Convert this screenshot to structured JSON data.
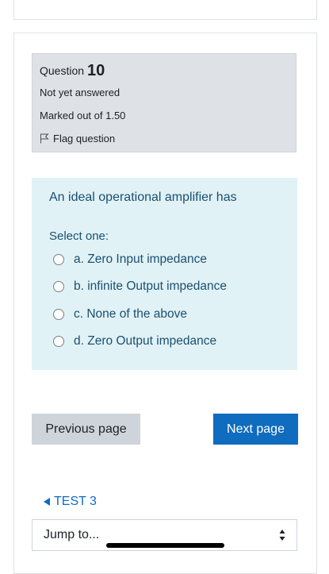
{
  "question": {
    "label": "Question",
    "number": "10",
    "status": "Not yet answered",
    "marks": "Marked out of 1.50",
    "flag_label": "Flag question"
  },
  "formulation": {
    "text": "An ideal operational amplifier has",
    "prompt": "Select one:",
    "options": [
      {
        "label": "a. Zero Input impedance",
        "selected": false
      },
      {
        "label": "b. infinite Output impedance",
        "selected": false
      },
      {
        "label": "c. None of the above",
        "selected": false
      },
      {
        "label": "d. Zero Output impedance",
        "selected": false
      }
    ]
  },
  "navigation": {
    "previous_label": "Previous page",
    "next_label": "Next page",
    "back_link": "TEST 3",
    "jump_label": "Jump to..."
  },
  "colors": {
    "primary": "#0f6cbf",
    "info_bg": "#dee2e6",
    "formulation_bg": "#e0f2f6",
    "formulation_text": "#1c4f6f"
  }
}
